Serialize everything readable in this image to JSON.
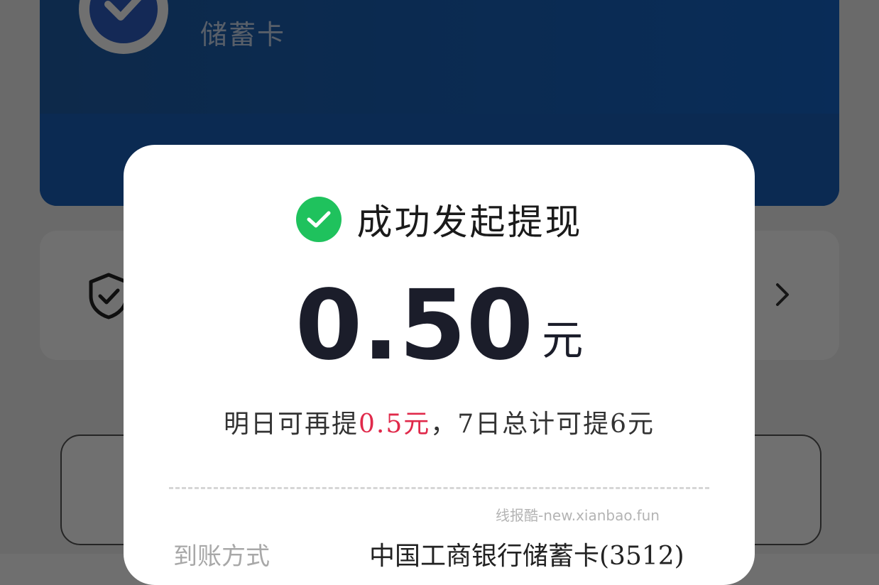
{
  "background": {
    "card_type": "储蓄卡",
    "colors": {
      "card_blue": "#1565c8",
      "overlay": "rgba(0,0,0,0.56)"
    },
    "icons": {
      "bank_logo": "bank-logo-icon",
      "shield": "shield-check-icon",
      "chevron": "chevron-right-icon"
    }
  },
  "modal": {
    "title": "成功发起提现",
    "amount": "0.50",
    "unit": "元",
    "sub_prefix": "明日可再提",
    "sub_highlight": "0.5元",
    "sub_suffix": "，7日总计可提6元",
    "watermark": "线报酷-new.xianbao.fun",
    "detail_label": "到账方式",
    "detail_value": "中国工商银行储蓄卡(3512)",
    "colors": {
      "success": "#1fc25d",
      "highlight": "#e0294a"
    },
    "icons": {
      "status": "check-circle-icon"
    }
  }
}
